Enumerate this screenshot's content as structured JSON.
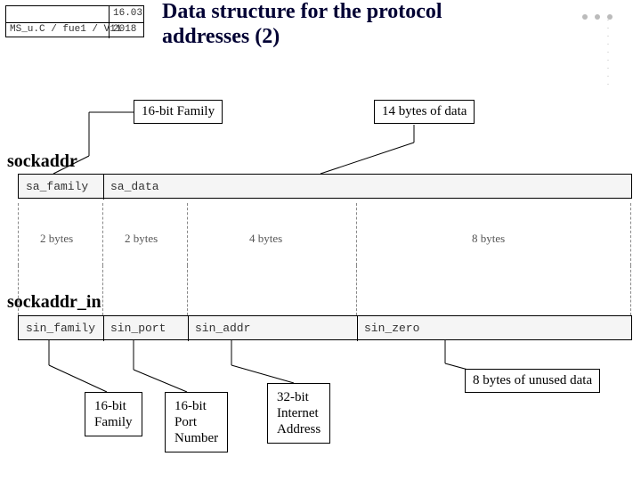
{
  "header": {
    "file_label": "MS_u.C / fue1 / V11",
    "date_top": "16.03",
    "date_bottom": "2018",
    "title_line1": "Data structure for the protocol",
    "title_line2": "addresses (2)"
  },
  "top_boxes": {
    "family": "16-bit Family",
    "data": "14 bytes of data"
  },
  "sockaddr": {
    "name": "sockaddr",
    "fields": {
      "sa_family": "sa_family",
      "sa_data": "sa_data"
    }
  },
  "sizes": {
    "b2a": "2 bytes",
    "b2b": "2 bytes",
    "b4": "4 bytes",
    "b8": "8 bytes"
  },
  "sockaddr_in": {
    "name": "sockaddr_in",
    "fields": {
      "sin_family": "sin_family",
      "sin_port": "sin_port",
      "sin_addr": "sin_addr",
      "sin_zero": "sin_zero"
    }
  },
  "bottom_boxes": {
    "family": "16-bit\nFamily",
    "port": "16-bit\nPort\nNumber",
    "addr": "32-bit\nInternet\nAddress",
    "zero": "8 bytes of unused data"
  }
}
